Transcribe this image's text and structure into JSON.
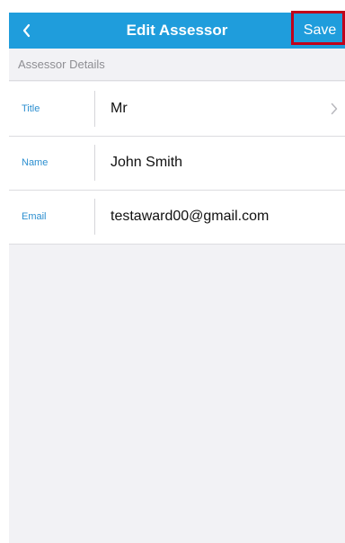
{
  "navbar": {
    "title": "Edit Assessor",
    "back_icon": "chevron-left-icon",
    "save_label": "Save",
    "color": "#1f9ddc"
  },
  "section": {
    "header": "Assessor Details"
  },
  "fields": [
    {
      "label": "Title",
      "value": "Mr",
      "has_chevron": true
    },
    {
      "label": "Name",
      "value": "John Smith",
      "has_chevron": false
    },
    {
      "label": "Email",
      "value": "testaward00@gmail.com",
      "has_chevron": false
    }
  ],
  "colors": {
    "accent": "#1f9ddc",
    "label": "#2c8fd0",
    "highlight": "#c0001a",
    "background": "#f2f2f5"
  }
}
